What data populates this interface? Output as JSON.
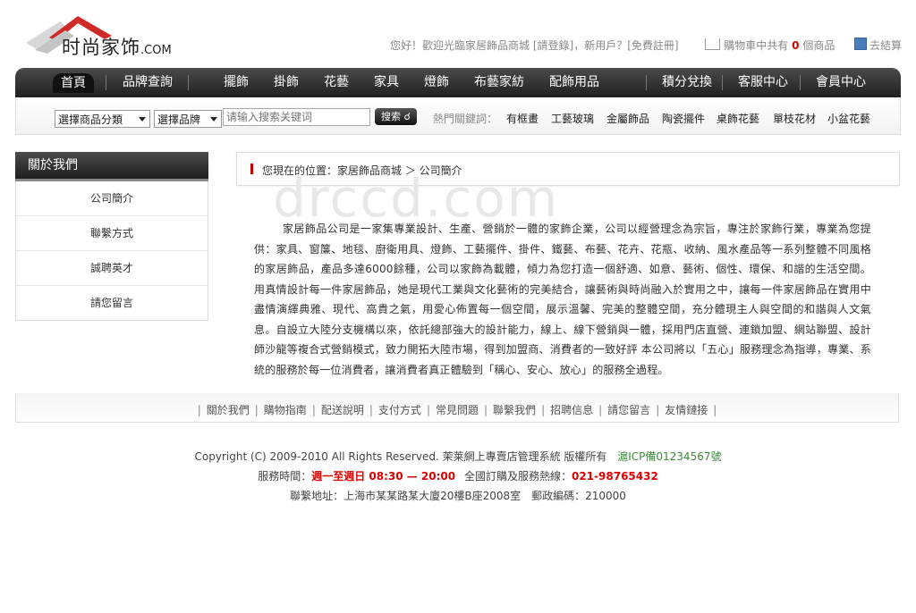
{
  "logo": {
    "text_main": "时尚家饰",
    "text_suffix": ".COM"
  },
  "top_links": {
    "welcome": "您好！歡迎光臨家居飾品商城",
    "login": "[請登錄]",
    "new_user": "，新用戶？",
    "register": "[免費註冊]",
    "cart_prefix": "購物車中共有",
    "cart_count": "0",
    "cart_suffix": "個商品",
    "checkout": "去結算"
  },
  "nav": {
    "home": "首頁",
    "brand": "品牌查詢",
    "items": [
      "擺飾",
      "掛飾",
      "花藝",
      "家具",
      "燈飾",
      "布藝家紡",
      "配飾用品"
    ],
    "points": "積分兌換",
    "service": "客服中心",
    "member": "會員中心"
  },
  "search": {
    "category_select": "選擇商品分類",
    "brand_select": "選擇品牌",
    "placeholder": "请输入搜索关键词",
    "button": "搜索",
    "hot_label": "熱門關鍵詞：",
    "hot_words": [
      "有框畫",
      "工藝玻璃",
      "金屬飾品",
      "陶瓷擺件",
      "桌飾花藝",
      "單枝花材",
      "小盆花藝"
    ]
  },
  "sidebar": {
    "title": "關於我們",
    "items": [
      "公司簡介",
      "聯繫方式",
      "誠聘英才",
      "請您留言"
    ]
  },
  "breadcrumb": {
    "text": "您現在的位置：家居飾品商城 ＞ 公司簡介"
  },
  "watermark": "drccd.com",
  "content": {
    "paragraph": "家居飾品公司是一家集專業設計、生產、營銷於一體的家飾企業，公司以經營理念為宗旨，專注於家飾行業，專業為您提供：家具、窗簾、地毯、廚衛用具、燈飾、工藝擺件、掛件、鐵藝、布藝、花卉、花瓶、收納、風水產品等一系列整體不同風格的家居飾品，產品多達6000餘種，公司以家飾為載體，傾力為您打造一個舒適、如意、藝術、個性、環保、和諧的生活空間。用真情設計每一件家居飾品，她是現代工業與文化藝術的完美結合，讓藝術與時尚融入於實用之中，讓每一件家居飾品在實用中盡情演繹典雅、現代、高貴之氣，用愛心佈置每一個空間，展示溫馨、完美的整體空間，充分體現主人與空間的和諧與人文氣息。自設立大陸分支機構以來，依託總部強大的設計能力，線上、線下營銷與一體，採用門店直營、連鎖加盟、網站聯盟、設計師沙龍等複合式營銷模式，致力開拓大陸市場，得到加盟商、消費者的一致好評 本公司將以「五心」服務理念為指導，專業、系統的服務於每一位消費者，讓消費者真正體驗到「稱心、安心、放心」的服務全過程。"
  },
  "footer": {
    "links": [
      "關於我們",
      "購物指南",
      "配送說明",
      "支付方式",
      "常見問題",
      "聯繫我們",
      "招聘信息",
      "請您留言",
      "友情鏈接"
    ],
    "copyright": "Copyright (C) 2009-2010 All Rights Reserved. 茉莱網上專賣店管理系統 版權所有",
    "icp": "滬ICP備01234567號",
    "hours_label": "服務時間：",
    "hours": "週一至週日 08:30 — 20:00",
    "hotline_label": "全國訂購及服務熱線：",
    "hotline": "021-98765432",
    "address": "聯繫地址：上海市某某路某大廈20樓B座2008室　郵政編碼：210000"
  },
  "colors": {
    "accent": "#cc0000",
    "nav_bg": "#2a2a2a",
    "icp": "#3a8a3a"
  }
}
